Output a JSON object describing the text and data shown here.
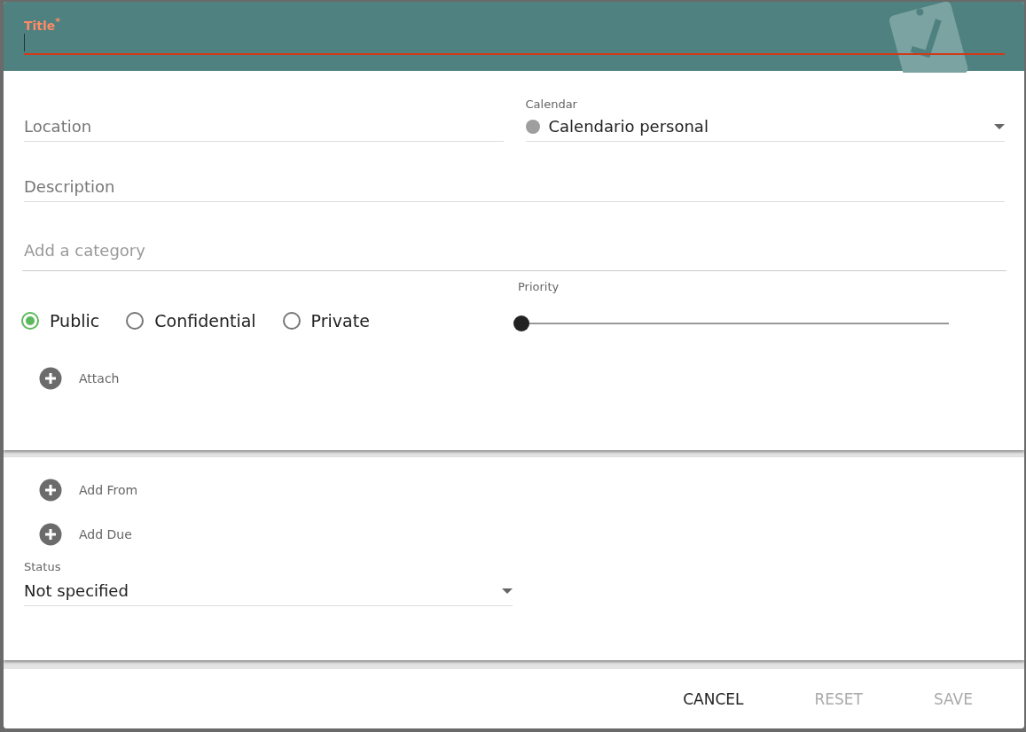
{
  "title_field": {
    "label": "Title",
    "required_mark": "*"
  },
  "location": {
    "placeholder": "Location"
  },
  "calendar": {
    "label": "Calendar",
    "value": "Calendario personal",
    "color": "#9e9e9e"
  },
  "description": {
    "placeholder": "Description"
  },
  "category": {
    "placeholder": "Add a category"
  },
  "classification": [
    {
      "label": "Public",
      "selected": true
    },
    {
      "label": "Confidential",
      "selected": false
    },
    {
      "label": "Private",
      "selected": false
    }
  ],
  "priority": {
    "label": "Priority",
    "level": 0
  },
  "attach": {
    "label": "Attach"
  },
  "dates": [
    {
      "label": "Add From"
    },
    {
      "label": "Add Due"
    }
  ],
  "status": {
    "label": "Status",
    "value": "Not specified"
  },
  "buttons": [
    {
      "label": "CANCEL",
      "disabled": false
    },
    {
      "label": "RESET",
      "disabled": true
    },
    {
      "label": "SAVE",
      "disabled": true
    }
  ]
}
